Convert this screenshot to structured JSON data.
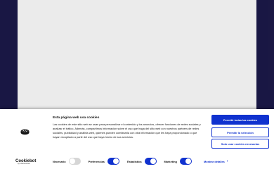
{
  "colors": {
    "accent": "#1032cf",
    "background": "#1c1a4a",
    "toggle_off": "#d6d6d6"
  },
  "banner": {
    "logo_icon": "cookie-icon",
    "brand_main": "Cookiebot",
    "brand_sub": "by Usercentrics",
    "title": "Esta página web usa cookies",
    "body": "Las cookies de este sitio web se usan para personalizar el contenido y los anuncios, ofrecer funciones de redes sociales y analizar el tráfico. Además, compartimos información sobre el uso que haga del sitio web con nuestros partners de redes sociales, publicidad y análisis web, quienes pueden combinarla con otra información que les haya proporcionado o que hayan recopilado a partir del uso que haya hecho de sus servicios.",
    "buttons": {
      "allow_all": "Permitir todas las cookies",
      "allow_selection": "Permitir la selección",
      "necessary_only": "Solo usar cookies necesarias"
    },
    "toggles": [
      {
        "label": "Necesario",
        "on": false
      },
      {
        "label": "Preferencias",
        "on": true
      },
      {
        "label": "Estadística",
        "on": true
      },
      {
        "label": "Marketing",
        "on": true
      }
    ],
    "show_details": "Mostrar detalles",
    "show_details_icon": "chevron-right-icon"
  }
}
